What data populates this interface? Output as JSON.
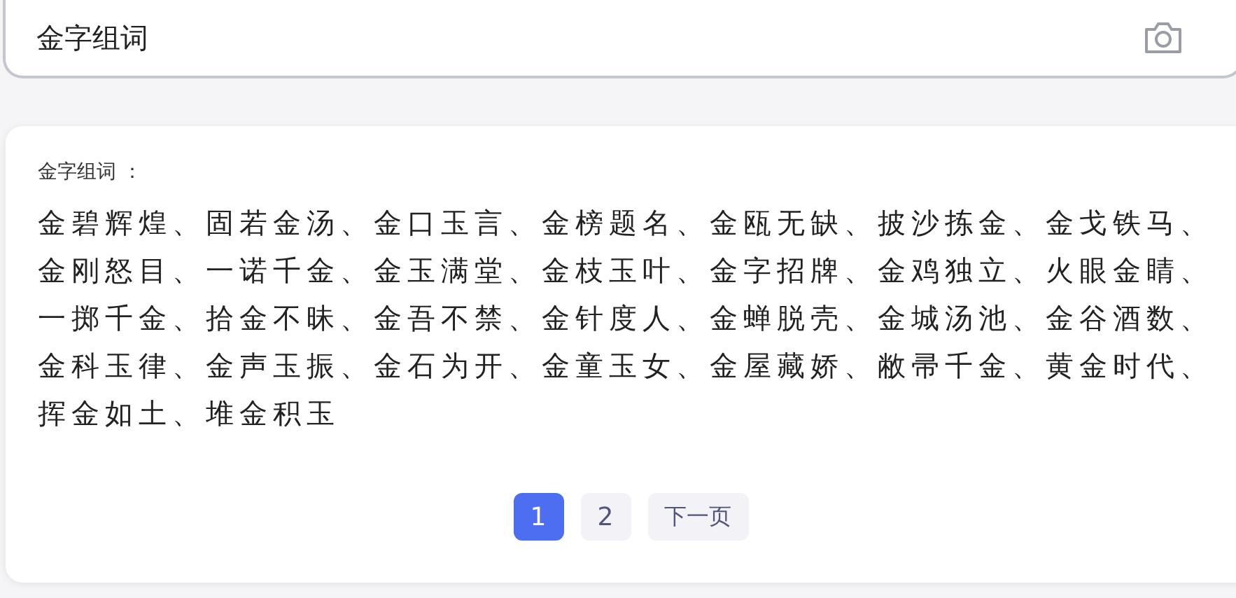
{
  "search": {
    "value": "金字组词"
  },
  "result": {
    "label": "金字组词 ：",
    "words": "金碧辉煌、固若金汤、金口玉言、金榜题名、金瓯无缺、披沙拣金、金戈铁马、金刚怒目、一诺千金、金玉满堂、金枝玉叶、金字招牌、金鸡独立、火眼金睛、一掷千金、拾金不昧、金吾不禁、金针度人、金蝉脱壳、金城汤池、金谷酒数、金科玉律、金声玉振、金石为开、金童玉女、金屋藏娇、敝帚千金、黄金时代、挥金如土、堆金积玉"
  },
  "pagination": {
    "pages": [
      {
        "label": "1",
        "selected": true
      },
      {
        "label": "2",
        "selected": false
      }
    ],
    "next": "下一页"
  }
}
